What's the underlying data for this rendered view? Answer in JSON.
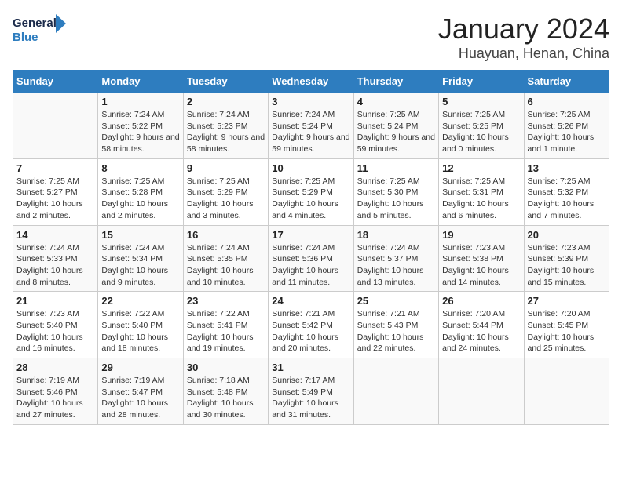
{
  "header": {
    "logo_line1": "General",
    "logo_line2": "Blue",
    "title": "January 2024",
    "subtitle": "Huayuan, Henan, China"
  },
  "columns": [
    "Sunday",
    "Monday",
    "Tuesday",
    "Wednesday",
    "Thursday",
    "Friday",
    "Saturday"
  ],
  "weeks": [
    [
      {
        "day": "",
        "sunrise": "",
        "sunset": "",
        "daylight": ""
      },
      {
        "day": "1",
        "sunrise": "7:24 AM",
        "sunset": "5:22 PM",
        "daylight": "9 hours and 58 minutes."
      },
      {
        "day": "2",
        "sunrise": "7:24 AM",
        "sunset": "5:23 PM",
        "daylight": "9 hours and 58 minutes."
      },
      {
        "day": "3",
        "sunrise": "7:24 AM",
        "sunset": "5:24 PM",
        "daylight": "9 hours and 59 minutes."
      },
      {
        "day": "4",
        "sunrise": "7:25 AM",
        "sunset": "5:24 PM",
        "daylight": "9 hours and 59 minutes."
      },
      {
        "day": "5",
        "sunrise": "7:25 AM",
        "sunset": "5:25 PM",
        "daylight": "10 hours and 0 minutes."
      },
      {
        "day": "6",
        "sunrise": "7:25 AM",
        "sunset": "5:26 PM",
        "daylight": "10 hours and 1 minute."
      }
    ],
    [
      {
        "day": "7",
        "sunrise": "7:25 AM",
        "sunset": "5:27 PM",
        "daylight": "10 hours and 2 minutes."
      },
      {
        "day": "8",
        "sunrise": "7:25 AM",
        "sunset": "5:28 PM",
        "daylight": "10 hours and 2 minutes."
      },
      {
        "day": "9",
        "sunrise": "7:25 AM",
        "sunset": "5:29 PM",
        "daylight": "10 hours and 3 minutes."
      },
      {
        "day": "10",
        "sunrise": "7:25 AM",
        "sunset": "5:29 PM",
        "daylight": "10 hours and 4 minutes."
      },
      {
        "day": "11",
        "sunrise": "7:25 AM",
        "sunset": "5:30 PM",
        "daylight": "10 hours and 5 minutes."
      },
      {
        "day": "12",
        "sunrise": "7:25 AM",
        "sunset": "5:31 PM",
        "daylight": "10 hours and 6 minutes."
      },
      {
        "day": "13",
        "sunrise": "7:25 AM",
        "sunset": "5:32 PM",
        "daylight": "10 hours and 7 minutes."
      }
    ],
    [
      {
        "day": "14",
        "sunrise": "7:24 AM",
        "sunset": "5:33 PM",
        "daylight": "10 hours and 8 minutes."
      },
      {
        "day": "15",
        "sunrise": "7:24 AM",
        "sunset": "5:34 PM",
        "daylight": "10 hours and 9 minutes."
      },
      {
        "day": "16",
        "sunrise": "7:24 AM",
        "sunset": "5:35 PM",
        "daylight": "10 hours and 10 minutes."
      },
      {
        "day": "17",
        "sunrise": "7:24 AM",
        "sunset": "5:36 PM",
        "daylight": "10 hours and 11 minutes."
      },
      {
        "day": "18",
        "sunrise": "7:24 AM",
        "sunset": "5:37 PM",
        "daylight": "10 hours and 13 minutes."
      },
      {
        "day": "19",
        "sunrise": "7:23 AM",
        "sunset": "5:38 PM",
        "daylight": "10 hours and 14 minutes."
      },
      {
        "day": "20",
        "sunrise": "7:23 AM",
        "sunset": "5:39 PM",
        "daylight": "10 hours and 15 minutes."
      }
    ],
    [
      {
        "day": "21",
        "sunrise": "7:23 AM",
        "sunset": "5:40 PM",
        "daylight": "10 hours and 16 minutes."
      },
      {
        "day": "22",
        "sunrise": "7:22 AM",
        "sunset": "5:40 PM",
        "daylight": "10 hours and 18 minutes."
      },
      {
        "day": "23",
        "sunrise": "7:22 AM",
        "sunset": "5:41 PM",
        "daylight": "10 hours and 19 minutes."
      },
      {
        "day": "24",
        "sunrise": "7:21 AM",
        "sunset": "5:42 PM",
        "daylight": "10 hours and 20 minutes."
      },
      {
        "day": "25",
        "sunrise": "7:21 AM",
        "sunset": "5:43 PM",
        "daylight": "10 hours and 22 minutes."
      },
      {
        "day": "26",
        "sunrise": "7:20 AM",
        "sunset": "5:44 PM",
        "daylight": "10 hours and 24 minutes."
      },
      {
        "day": "27",
        "sunrise": "7:20 AM",
        "sunset": "5:45 PM",
        "daylight": "10 hours and 25 minutes."
      }
    ],
    [
      {
        "day": "28",
        "sunrise": "7:19 AM",
        "sunset": "5:46 PM",
        "daylight": "10 hours and 27 minutes."
      },
      {
        "day": "29",
        "sunrise": "7:19 AM",
        "sunset": "5:47 PM",
        "daylight": "10 hours and 28 minutes."
      },
      {
        "day": "30",
        "sunrise": "7:18 AM",
        "sunset": "5:48 PM",
        "daylight": "10 hours and 30 minutes."
      },
      {
        "day": "31",
        "sunrise": "7:17 AM",
        "sunset": "5:49 PM",
        "daylight": "10 hours and 31 minutes."
      },
      {
        "day": "",
        "sunrise": "",
        "sunset": "",
        "daylight": ""
      },
      {
        "day": "",
        "sunrise": "",
        "sunset": "",
        "daylight": ""
      },
      {
        "day": "",
        "sunrise": "",
        "sunset": "",
        "daylight": ""
      }
    ]
  ]
}
